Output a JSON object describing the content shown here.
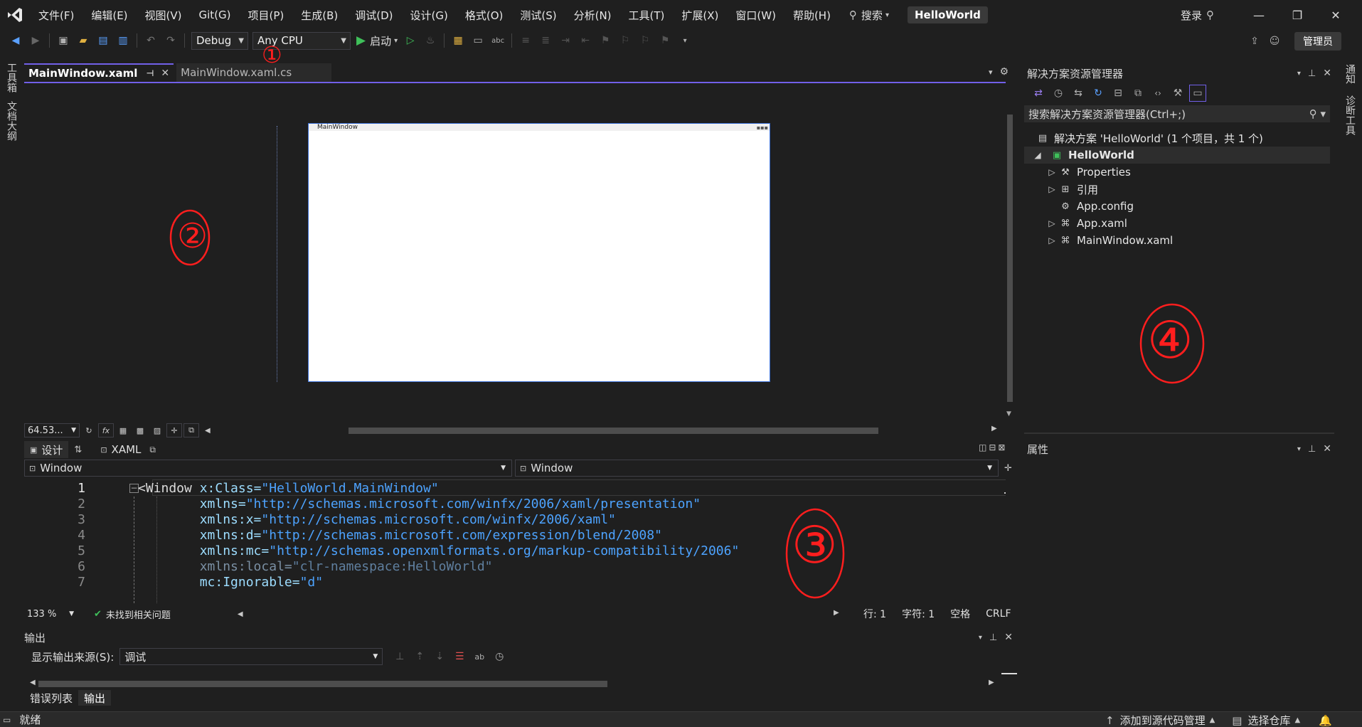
{
  "menu": {
    "items": [
      "文件(F)",
      "编辑(E)",
      "视图(V)",
      "Git(G)",
      "项目(P)",
      "生成(B)",
      "调试(D)",
      "设计(G)",
      "格式(O)",
      "测试(S)",
      "分析(N)",
      "工具(T)",
      "扩展(X)",
      "窗口(W)",
      "帮助(H)"
    ],
    "search_label": "搜索",
    "project_name": "HelloWorld",
    "login_label": "登录",
    "admin_label": "管理员"
  },
  "toolbar": {
    "config": "Debug",
    "platform": "Any CPU",
    "start_label": "启动"
  },
  "left_tabs": [
    "工具箱",
    "文档大纲"
  ],
  "right_tabs": [
    "通知",
    "诊断工具"
  ],
  "doc_tabs": {
    "active": "MainWindow.xaml",
    "inactive": "MainWindow.xaml.cs"
  },
  "designer": {
    "window_title": "MainWindow",
    "zoom": "64.53...",
    "fx_label": "fx"
  },
  "split_tabs": {
    "design": "设计",
    "xaml": "XAML"
  },
  "navbar": {
    "left": "Window",
    "right": "Window"
  },
  "code_lines": [
    {
      "n": "1",
      "parts": [
        {
          "t": "<Window ",
          "c": "c-tag"
        },
        {
          "t": "x",
          "c": "c-attr"
        },
        {
          "t": ":Class=",
          "c": "c-attr"
        },
        {
          "t": "\"HelloWorld.MainWindow\"",
          "c": "c-val"
        }
      ]
    },
    {
      "n": "2",
      "parts": [
        {
          "t": "        xmlns=",
          "c": "c-attr"
        },
        {
          "t": "\"http://schemas.microsoft.com/winfx/2006/xaml/presentation\"",
          "c": "c-val"
        }
      ]
    },
    {
      "n": "3",
      "parts": [
        {
          "t": "        xmlns:x=",
          "c": "c-attr"
        },
        {
          "t": "\"http://schemas.microsoft.com/winfx/2006/xaml\"",
          "c": "c-val"
        }
      ]
    },
    {
      "n": "4",
      "parts": [
        {
          "t": "        xmlns:d=",
          "c": "c-attr"
        },
        {
          "t": "\"http://schemas.microsoft.com/expression/blend/2008\"",
          "c": "c-val"
        }
      ]
    },
    {
      "n": "5",
      "parts": [
        {
          "t": "        xmlns:mc=",
          "c": "c-attr"
        },
        {
          "t": "\"http://schemas.openxmlformats.org/markup-compatibility/2006\"",
          "c": "c-val"
        }
      ]
    },
    {
      "n": "6",
      "parts": [
        {
          "t": "        xmlns:local=",
          "c": "c-gray"
        },
        {
          "t": "\"clr-namespace:HelloWorld\"",
          "c": "c-grayval"
        }
      ]
    },
    {
      "n": "7",
      "parts": [
        {
          "t": "        mc:Ignorable=",
          "c": "c-attr"
        },
        {
          "t": "\"d\"",
          "c": "c-val"
        }
      ]
    }
  ],
  "editor_status": {
    "zoom": "133 %",
    "issues": "未找到相关问题",
    "line": "行: 1",
    "char": "字符: 1",
    "spaces": "空格",
    "eol": "CRLF"
  },
  "output": {
    "title": "输出",
    "source_label": "显示输出来源(S):",
    "source_value": "调试"
  },
  "bottom_tabs": [
    "错误列表",
    "输出"
  ],
  "statusbar": {
    "ready": "就绪",
    "add_source": "添加到源代码管理",
    "select_repo": "选择仓库"
  },
  "solution": {
    "title": "解决方案资源管理器",
    "search_placeholder": "搜索解决方案资源管理器(Ctrl+;)",
    "solution_label": "解决方案 'HelloWorld' (1 个项目，共 1 个)",
    "project": "HelloWorld",
    "items": [
      "Properties",
      "引用",
      "App.config",
      "App.xaml",
      "MainWindow.xaml"
    ]
  },
  "properties": {
    "title": "属性"
  },
  "annotations": [
    "①",
    "②",
    "③",
    "④"
  ]
}
